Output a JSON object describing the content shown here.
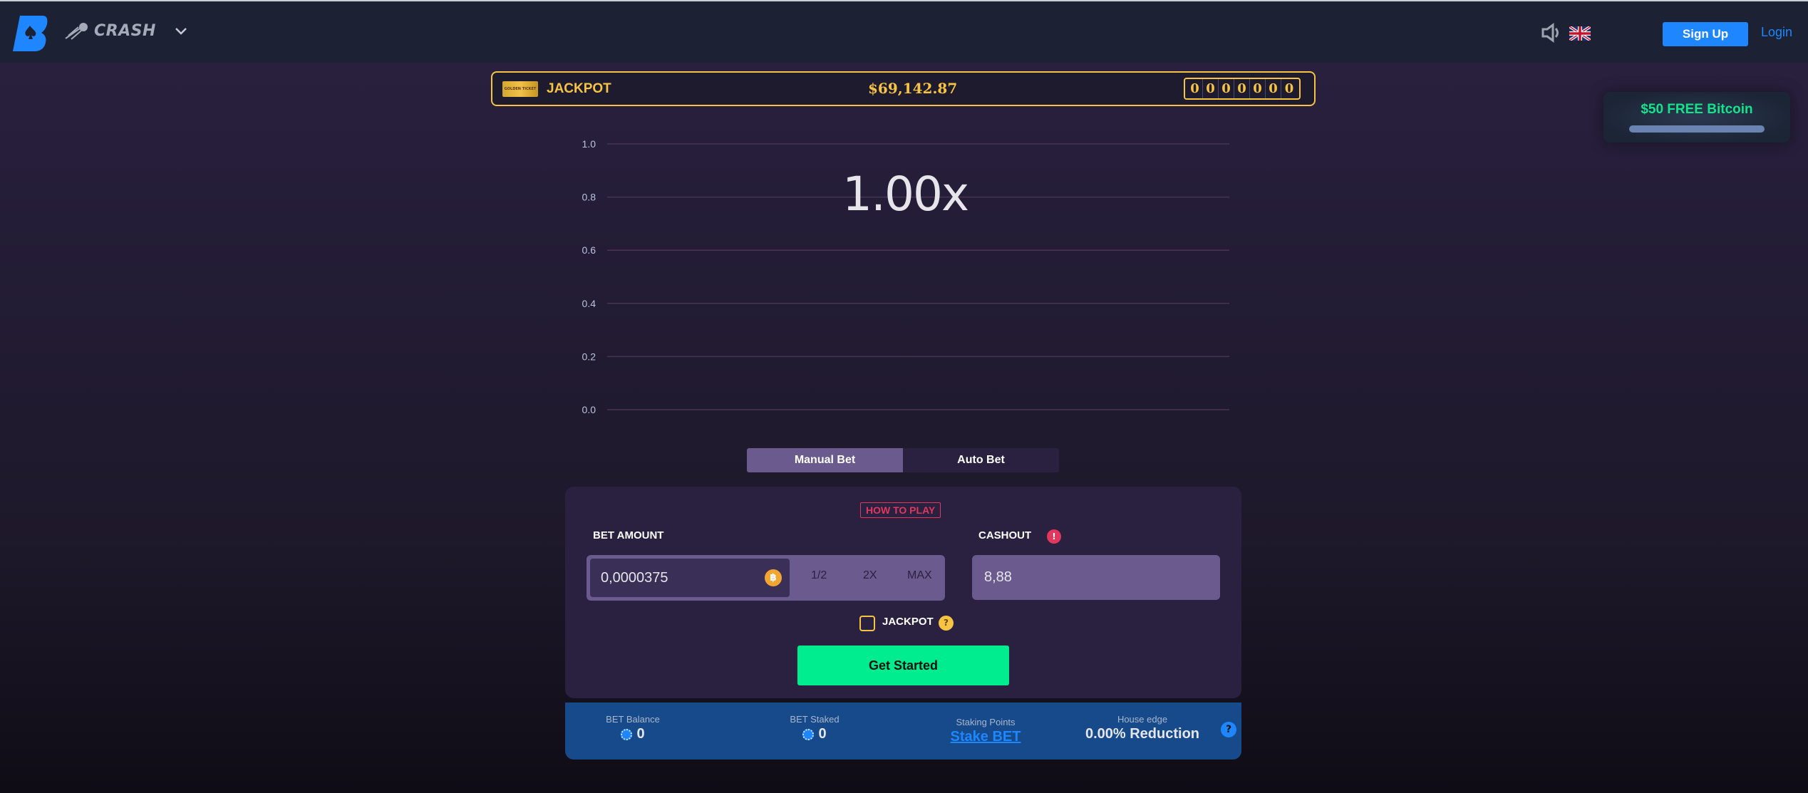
{
  "header": {
    "game_title": "CRASH",
    "signup_label": "Sign Up",
    "login_label": "Login",
    "icons": [
      "logo-b-spade",
      "rocket-icon",
      "chevron-down-icon",
      "speaker-icon",
      "uk-flag-icon"
    ]
  },
  "jackpot": {
    "ticket_text": "GOLDEN TICKET",
    "label": "JACKPOT",
    "amount": "$69,142.87",
    "digits": [
      "0",
      "0",
      "0",
      "0",
      "0",
      "0",
      "0"
    ],
    "accent_color": "#f6c343"
  },
  "promo": {
    "text": "$50 FREE Bitcoin"
  },
  "game": {
    "multiplier": "1.00x",
    "chart_data": {
      "type": "line",
      "title": "",
      "xlabel": "",
      "ylabel": "",
      "y_ticks": [
        "1.0",
        "0.8",
        "0.6",
        "0.4",
        "0.2",
        "0.0"
      ],
      "ylim": [
        0,
        1
      ],
      "grid": true,
      "series": []
    }
  },
  "tabs": [
    {
      "label": "Manual Bet",
      "active": true
    },
    {
      "label": "Auto Bet",
      "active": false
    }
  ],
  "bet_panel": {
    "how_to_play": "HOW TO PLAY",
    "bet_amount_label": "BET AMOUNT",
    "bet_amount_value": "0,0000375",
    "currency_icon": "฿",
    "half_label": "1/2",
    "double_label": "2X",
    "max_label": "MAX",
    "cashout_label": "CASHOUT",
    "cashout_value": "8,88",
    "warn_glyph": "!",
    "jackpot_check_label": "JACKPOT",
    "jackpot_checked": false,
    "help_glyph": "?",
    "submit_label": "Get Started",
    "submit_color": "#00ed8f"
  },
  "stats": {
    "bet_balance_label": "BET Balance",
    "bet_balance_value": "0",
    "bet_staked_label": "BET Staked",
    "bet_staked_value": "0",
    "staking_points_label": "Staking Points",
    "staking_points_link": "Stake BET",
    "house_edge_label": "House edge",
    "house_edge_value": "0.00% Reduction",
    "help_glyph": "?"
  }
}
